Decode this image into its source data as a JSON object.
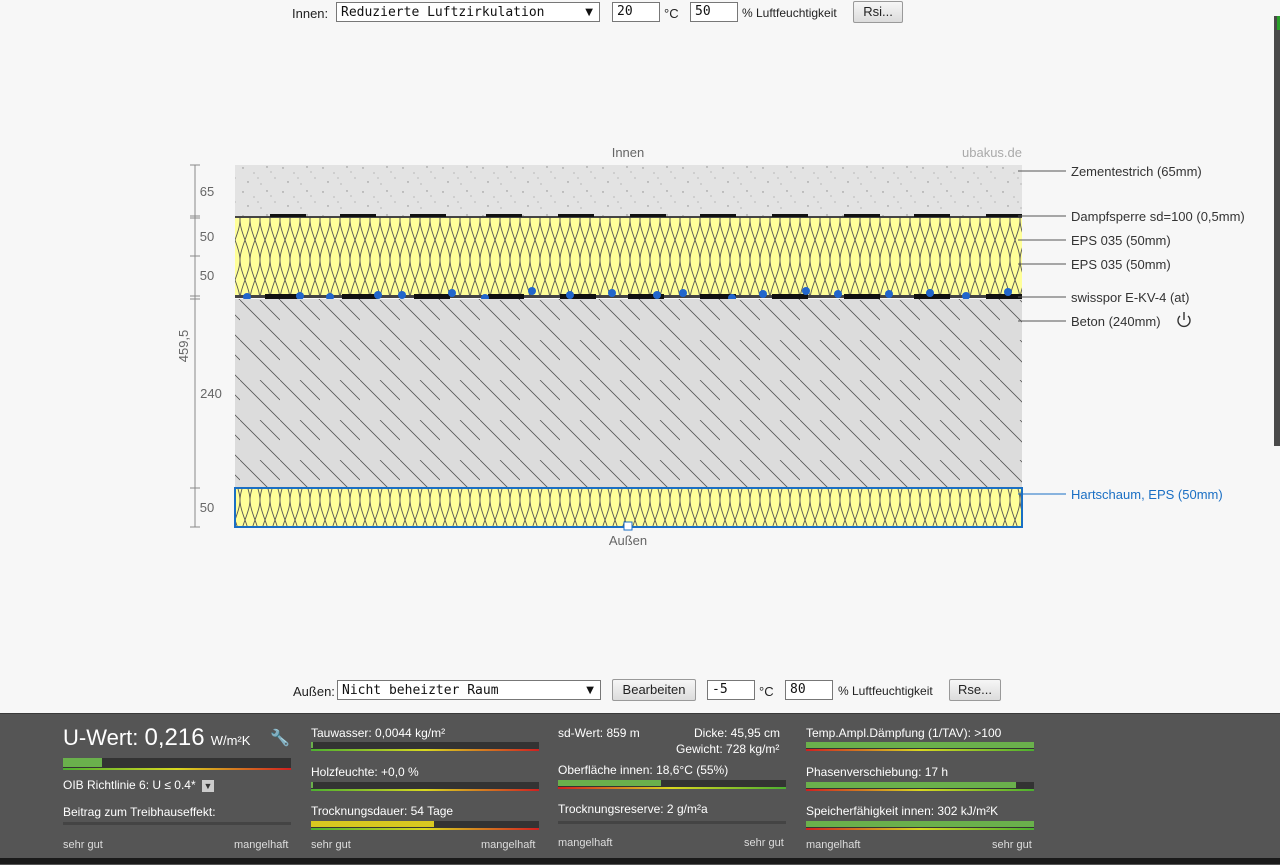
{
  "inside_bar": {
    "label": "Innen:",
    "condition": "Reduzierte Luftzirkulation",
    "temp": "20",
    "temp_unit": "°C",
    "humidity": "50",
    "humidity_unit": "% Luftfeuchtigkeit",
    "rsi_button": "Rsi..."
  },
  "outside_bar": {
    "label": "Außen:",
    "condition": "Nicht beheizter Raum",
    "edit_button": "Bearbeiten",
    "temp": "-5",
    "temp_unit": "°C",
    "humidity": "80",
    "humidity_unit": "% Luftfeuchtigkeit",
    "rse_button": "Rse..."
  },
  "diagram": {
    "top_label": "Innen",
    "bottom_label": "Außen",
    "watermark": "ubakus.de",
    "total_thickness": "459,5",
    "layers": [
      {
        "name": "Zementestrich (65mm)",
        "thickness": "65"
      },
      {
        "name": "Dampfsperre sd=100 (0,5mm)",
        "thickness": ""
      },
      {
        "name": "EPS 035 (50mm)",
        "thickness": "50"
      },
      {
        "name": "EPS 035 (50mm)",
        "thickness": "50"
      },
      {
        "name": "swisspor E-KV-4 (at)",
        "thickness": ""
      },
      {
        "name": "Beton (240mm)",
        "thickness": "240"
      },
      {
        "name": "Hartschaum, EPS (50mm)",
        "thickness": "50"
      }
    ],
    "colors": {
      "insulation": "#ffff99",
      "concrete": "#dcdcdc",
      "screed": "#e0e0e0",
      "selected": "#1a6fc4"
    }
  },
  "results": {
    "u_label": "U-Wert:",
    "u_value": "0,216",
    "u_unit": "W/m²K",
    "u_bar": 0.17,
    "oib": "OIB Richtlinie 6: U ≤ 0.4*",
    "greenhouse": "Beitrag zum Treibhauseffekt:",
    "scale_good": "sehr gut",
    "scale_bad": "mangelhaft",
    "tauwasser": "Tauwasser: 0,0044 kg/m²",
    "tauwasser_bar": 0.01,
    "holzfeuchte": "Holzfeuchte: +0,0 %",
    "holzfeuchte_bar": 0.01,
    "trocknung": "Trocknungsdauer: 54 Tage",
    "trocknung_bar": 0.54,
    "sd_wert": "sd-Wert: 859 m",
    "dicke": "Dicke: 45,95 cm",
    "gewicht": "Gewicht: 728 kg/m²",
    "oberflaeche": "Oberfläche innen: 18,6°C (55%)",
    "oberflaeche_bar": 0.45,
    "reserve": "Trocknungsreserve: 2 g/m²a",
    "reserve_bar": 0.0,
    "temp_amp": "Temp.Ampl.Dämpfung (1/TAV): >100",
    "temp_amp_bar": 1.0,
    "phase": "Phasenverschiebung: 17 h",
    "phase_bar": 0.92,
    "speicher": "Speicherfähigkeit innen: 302 kJ/m²K",
    "speicher_bar": 1.0,
    "scale_bad_first": "mangelhaft",
    "scale_good_last": "sehr gut"
  }
}
